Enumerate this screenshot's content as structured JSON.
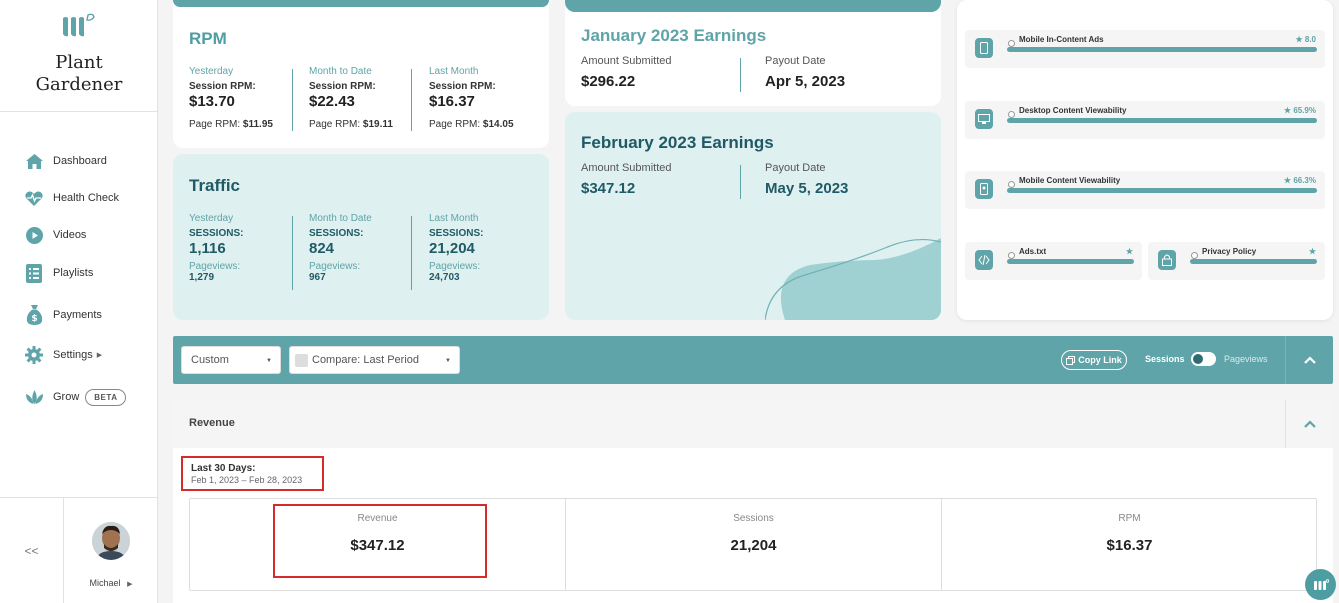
{
  "brand": {
    "name_line1": "Plant",
    "name_line2": "Gardener"
  },
  "nav": [
    {
      "label": "Dashboard",
      "icon": "home-icon"
    },
    {
      "label": "Health Check",
      "icon": "heartbeat-icon"
    },
    {
      "label": "Videos",
      "icon": "play-icon"
    },
    {
      "label": "Playlists",
      "icon": "list-icon"
    },
    {
      "label": "Payments",
      "icon": "money-bag-icon"
    },
    {
      "label": "Settings",
      "icon": "gear-icon"
    },
    {
      "label": "Grow",
      "icon": "leaf-icon",
      "badge": "BETA"
    }
  ],
  "sidebar_bottom": {
    "collapse": "<<",
    "user": "Michael"
  },
  "rpm": {
    "title": "RPM",
    "cols": [
      {
        "period": "Yesterday",
        "label": "Session RPM:",
        "value": "$13.70",
        "page_label": "Page RPM: ",
        "page_value": "$11.95"
      },
      {
        "period": "Month to Date",
        "label": "Session RPM:",
        "value": "$22.43",
        "page_label": "Page RPM: ",
        "page_value": "$19.11"
      },
      {
        "period": "Last Month",
        "label": "Session RPM:",
        "value": "$16.37",
        "page_label": "Page RPM: ",
        "page_value": "$14.05"
      }
    ]
  },
  "traffic": {
    "title": "Traffic",
    "cols": [
      {
        "period": "Yesterday",
        "label": "SESSIONS:",
        "value": "1,116",
        "pv_label": "Pageviews:",
        "pv_value": "1,279"
      },
      {
        "period": "Month to Date",
        "label": "SESSIONS:",
        "value": "824",
        "pv_label": "Pageviews:",
        "pv_value": "967"
      },
      {
        "period": "Last Month",
        "label": "SESSIONS:",
        "value": "21,204",
        "pv_label": "Pageviews:",
        "pv_value": "24,703"
      }
    ]
  },
  "earnings": {
    "jan": {
      "title": "January 2023 Earnings",
      "amount_label": "Amount Submitted",
      "amount": "$296.22",
      "payout_label": "Payout Date",
      "payout": "Apr 5, 2023"
    },
    "feb": {
      "title": "February 2023 Earnings",
      "amount_label": "Amount Submitted",
      "amount": "$347.12",
      "payout_label": "Payout Date",
      "payout": "May 5, 2023"
    }
  },
  "health": [
    {
      "label": "Mobile In-Content Ads",
      "score": "8.0",
      "level": 1.0,
      "icon": "mobile-icon"
    },
    {
      "label": "Desktop Content Viewability",
      "score": "65.9%",
      "level": 1.0,
      "icon": "desktop-icon"
    },
    {
      "label": "Mobile Content Viewability",
      "score": "66.3%",
      "level": 1.0,
      "icon": "mobile-view-icon"
    },
    {
      "label": "Ads.txt",
      "score": "",
      "level": 1.0,
      "icon": "code-icon"
    },
    {
      "label": "Privacy Policy",
      "score": "",
      "level": 1.0,
      "icon": "lock-icon"
    }
  ],
  "filter": {
    "range_select": "Custom",
    "compare_select": "Compare: Last Period",
    "copy_link": "Copy Link",
    "toggle_left": "Sessions",
    "toggle_right": "Pageviews"
  },
  "revenue": {
    "title": "Revenue",
    "range_title": "Last 30 Days:",
    "range_dates": "Feb 1, 2023 – Feb 28, 2023",
    "metrics": [
      {
        "label": "Revenue",
        "value": "$347.12"
      },
      {
        "label": "Sessions",
        "value": "21,204"
      },
      {
        "label": "RPM",
        "value": "$16.37"
      }
    ]
  },
  "colors": {
    "teal": "#5fa4a8",
    "teal_dark": "#1f5a66",
    "light_teal": "#dff0f0",
    "highlight": "#d52b2b"
  }
}
